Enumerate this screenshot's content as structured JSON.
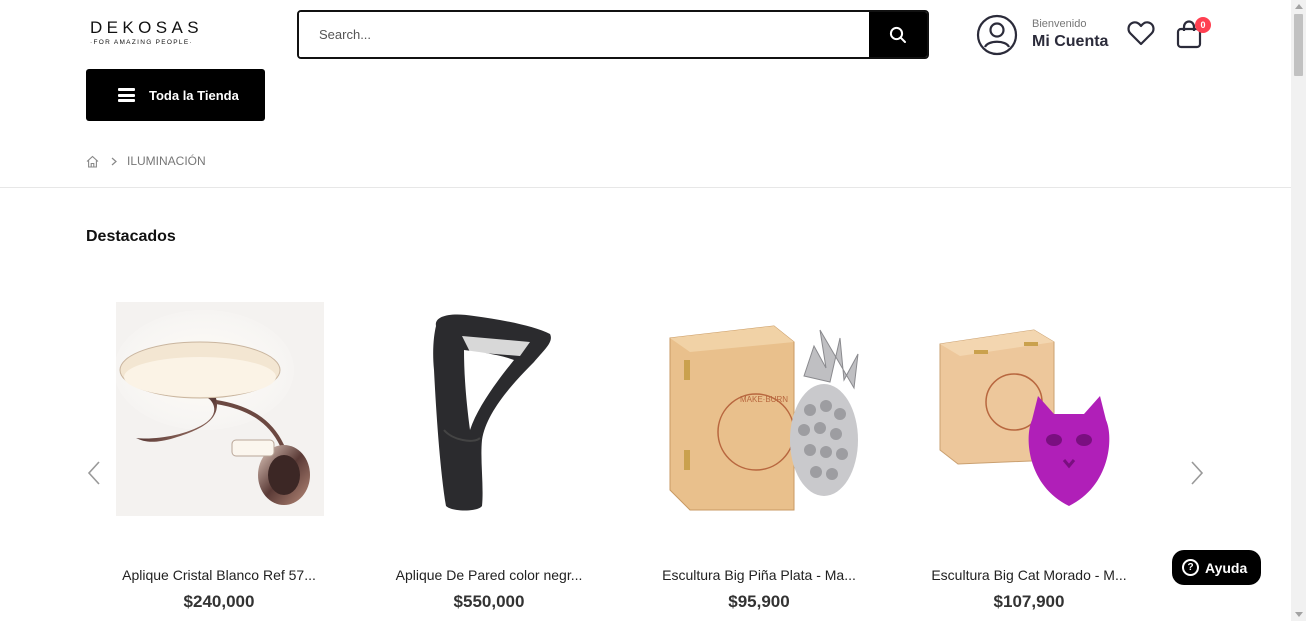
{
  "header": {
    "logo": {
      "brand": "DEKOSAS",
      "tagline": "·FOR AMAZING PEOPLE·"
    },
    "search": {
      "placeholder": "Search..."
    },
    "account": {
      "greeting": "Bienvenido",
      "label": "Mi Cuenta"
    },
    "cart": {
      "count": "0"
    },
    "icons": {
      "search": "search-icon",
      "account": "user-icon",
      "wishlist": "heart-icon",
      "cart": "shopping-bag-icon"
    }
  },
  "nav": {
    "store_button": "Toda la Tienda"
  },
  "breadcrumb": {
    "home": "home-icon",
    "current": "ILUMINACIÓN"
  },
  "section": {
    "title": "Destacados"
  },
  "products": [
    {
      "title": "Aplique Cristal Blanco Ref 57...",
      "price": "$240,000"
    },
    {
      "title": "Aplique De Pared color negr...",
      "price": "$550,000"
    },
    {
      "title": "Escultura Big Piña Plata - Ma...",
      "price": "$95,900"
    },
    {
      "title": "Escultura Big Cat Morado - M...",
      "price": "$107,900"
    }
  ],
  "help": {
    "label": "Ayuda"
  },
  "colors": {
    "accent": "#000000",
    "badge": "#ff4051",
    "purple": "#b01fb8"
  }
}
